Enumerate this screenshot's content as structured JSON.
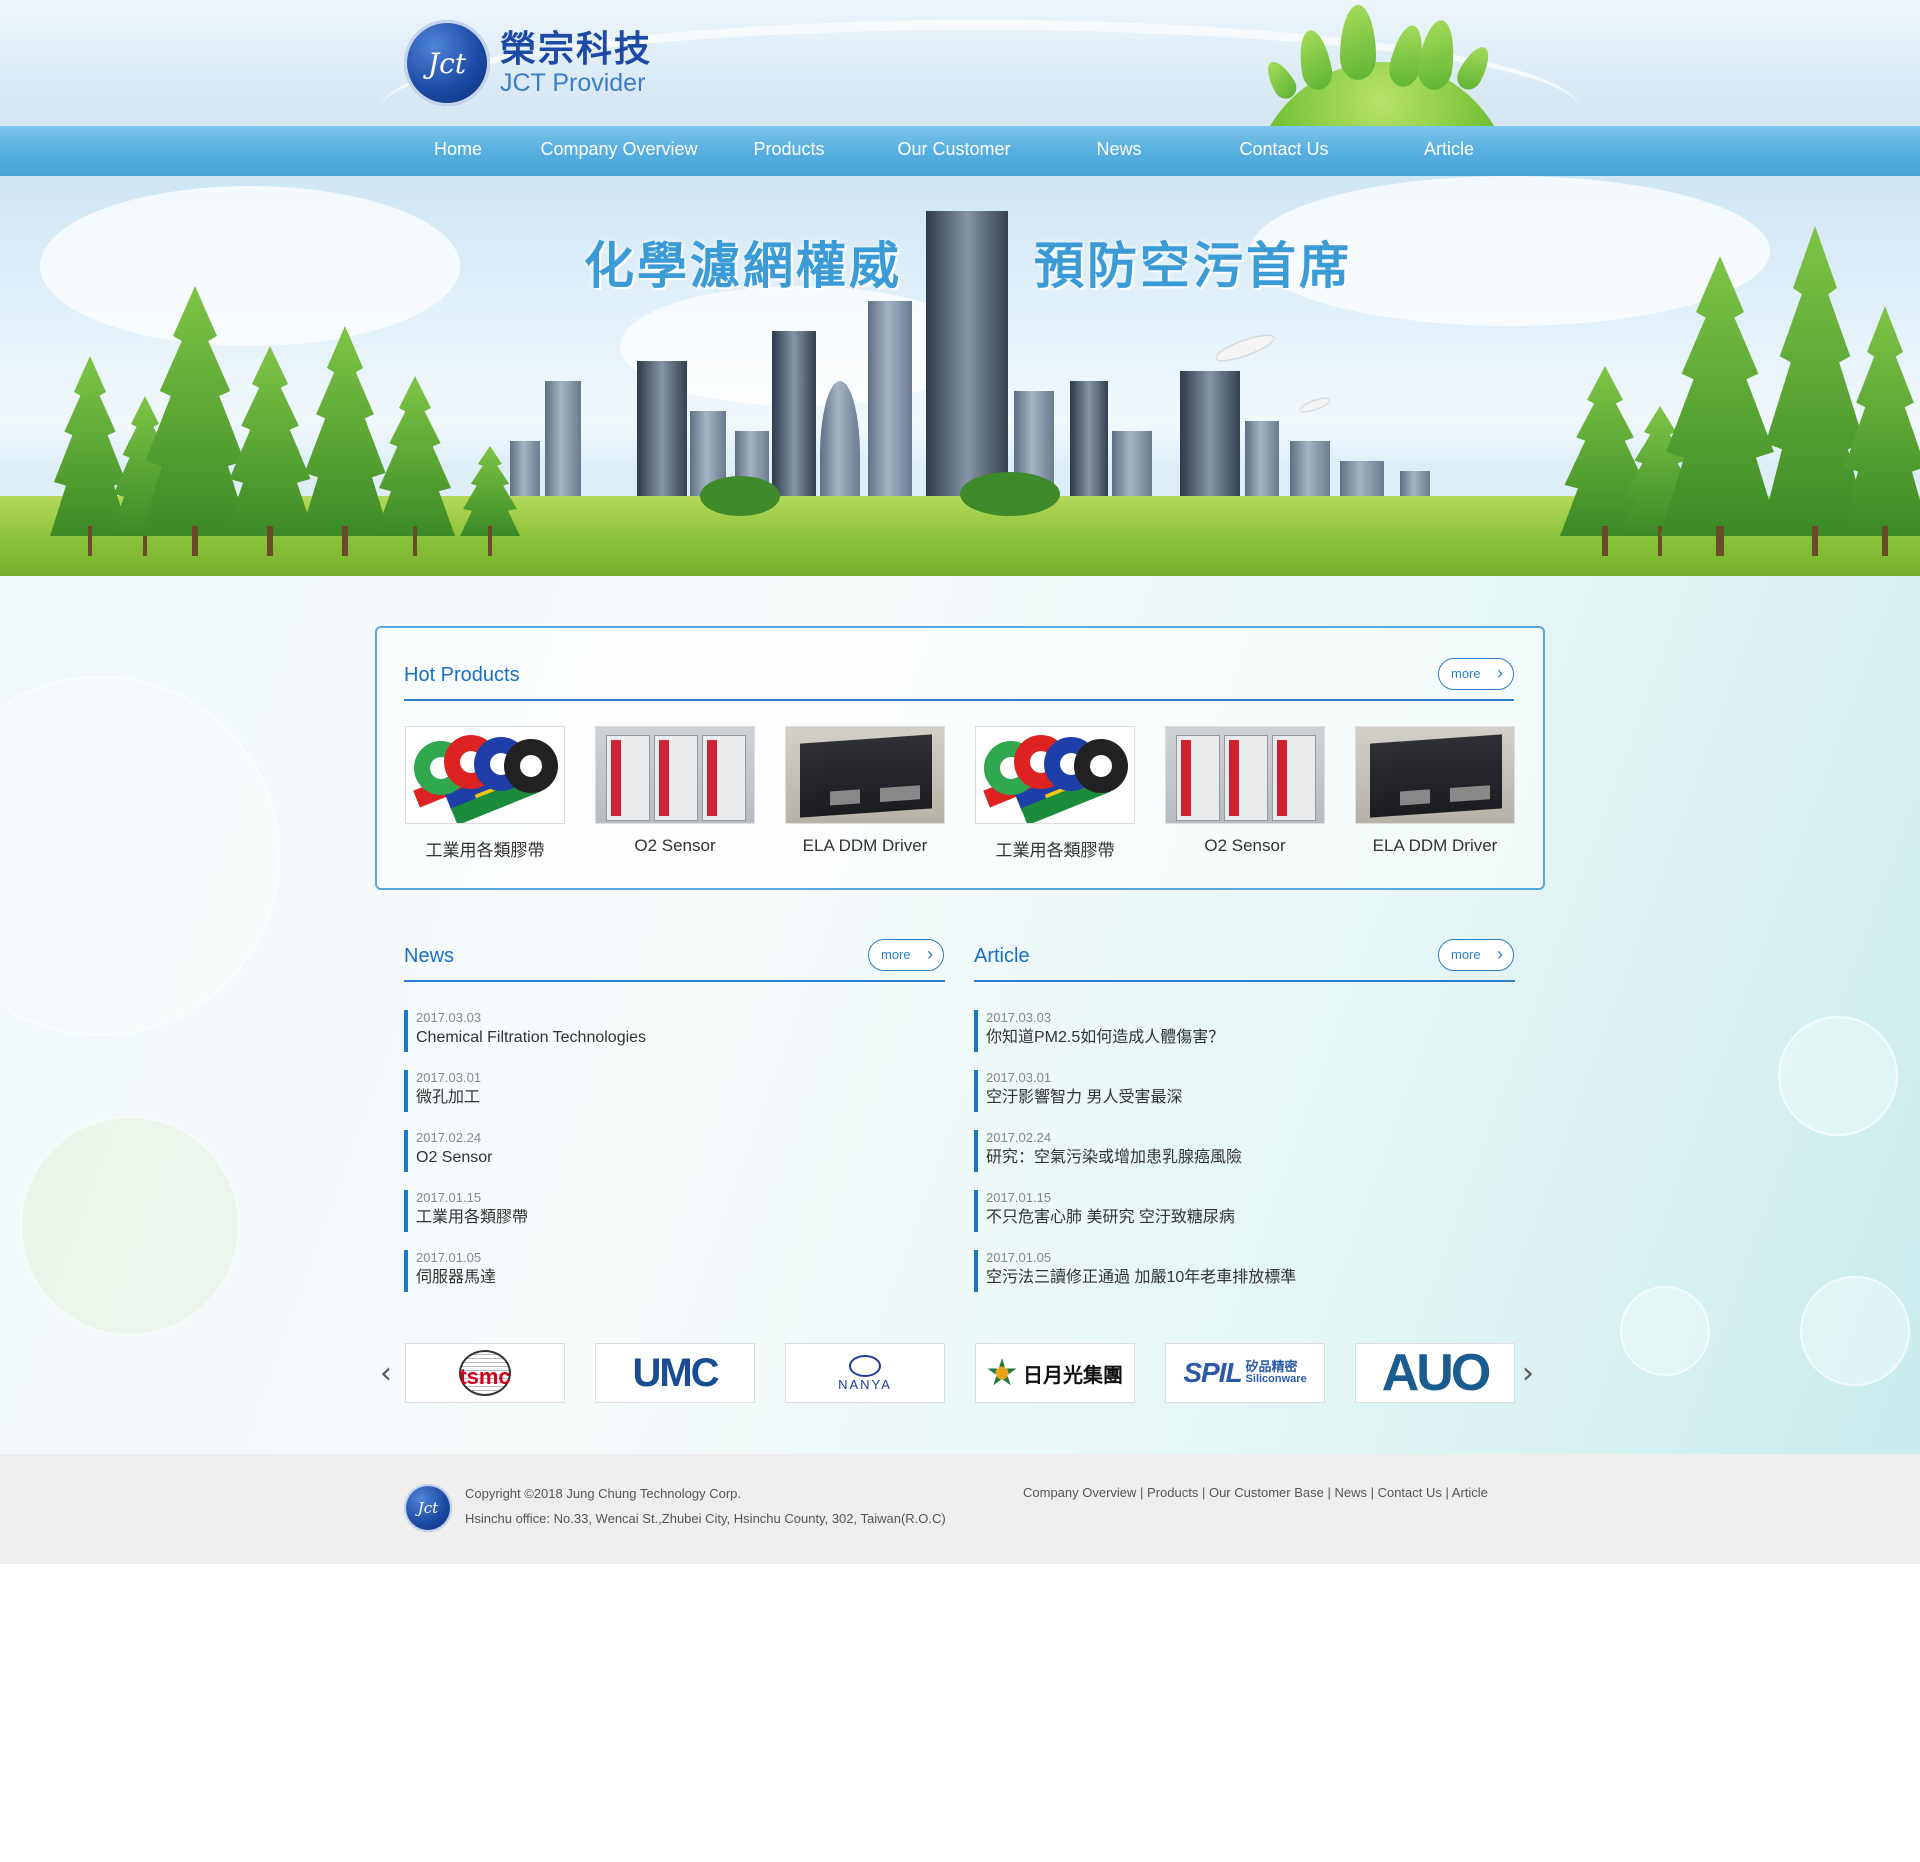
{
  "brand": {
    "logo_mark": "Jct",
    "name_zh": "榮宗科技",
    "name_en": "JCT Provider"
  },
  "nav": [
    {
      "label": "Home"
    },
    {
      "label": "Company Overview"
    },
    {
      "label": "Products"
    },
    {
      "label": "Our Customer"
    },
    {
      "label": "News"
    },
    {
      "label": "Contact Us"
    },
    {
      "label": "Article"
    }
  ],
  "banner": {
    "slogan_left": "化學濾網權威",
    "slogan_right": "預防空污首席"
  },
  "hot_products": {
    "title": "Hot Products",
    "more_label": "more",
    "items": [
      {
        "name": "工業用各類膠帶",
        "image": "tape-image"
      },
      {
        "name": "O2 Sensor",
        "image": "cabinet-image"
      },
      {
        "name": "ELA DDM Driver",
        "image": "driver-image"
      },
      {
        "name": "工業用各類膠帶",
        "image": "tape-image"
      },
      {
        "name": "O2 Sensor",
        "image": "cabinet-image"
      },
      {
        "name": "ELA DDM Driver",
        "image": "driver-image"
      }
    ]
  },
  "news": {
    "title": "News",
    "more_label": "more",
    "items": [
      {
        "date": "2017.03.03",
        "text": "Chemical Filtration Technologies"
      },
      {
        "date": "2017.03.01",
        "text": "微孔加工"
      },
      {
        "date": "2017.02.24",
        "text": "O2 Sensor"
      },
      {
        "date": "2017.01.15",
        "text": "工業用各類膠帶"
      },
      {
        "date": "2017.01.05",
        "text": "伺服器馬達"
      }
    ]
  },
  "article": {
    "title": "Article",
    "more_label": "more",
    "items": [
      {
        "date": "2017.03.03",
        "text": "你知道PM2.5如何造成人體傷害？"
      },
      {
        "date": "2017.03.01",
        "text": "空汙影響智力 男人受害最深"
      },
      {
        "date": "2017.02.24",
        "text": "研究：空氣污染或增加患乳腺癌風險"
      },
      {
        "date": "2017.01.15",
        "text": "不只危害心肺 美研究 空汙致糖尿病"
      },
      {
        "date": "2017.01.05",
        "text": "空污法三讀修正通過 加嚴10年老車排放標準"
      }
    ]
  },
  "partners": {
    "prev_icon": "chevron-left-icon",
    "next_icon": "chevron-right-icon",
    "items": [
      {
        "name": "tsmc"
      },
      {
        "name": "UMC"
      },
      {
        "name": "NANYA"
      },
      {
        "name": "日月光集團"
      },
      {
        "name": "SPIL",
        "sub": "矽品精密",
        "sub2": "Siliconware"
      },
      {
        "name": "AUO"
      }
    ]
  },
  "footer": {
    "copyright": "Copyright ©2018 Jung Chung Technology Corp.",
    "address": "Hsinchu office: No.33, Wencai St.,Zhubei City, Hsinchu County, 302, Taiwan(R.O.C)",
    "links": [
      "Company Overview",
      "Products",
      "Our Customer Base",
      "News",
      "Contact Us",
      "Article"
    ],
    "separator": " | "
  },
  "colors": {
    "accent": "#1a6fc4",
    "nav": "#57afe0",
    "footer_bg": "#eeeeee"
  }
}
